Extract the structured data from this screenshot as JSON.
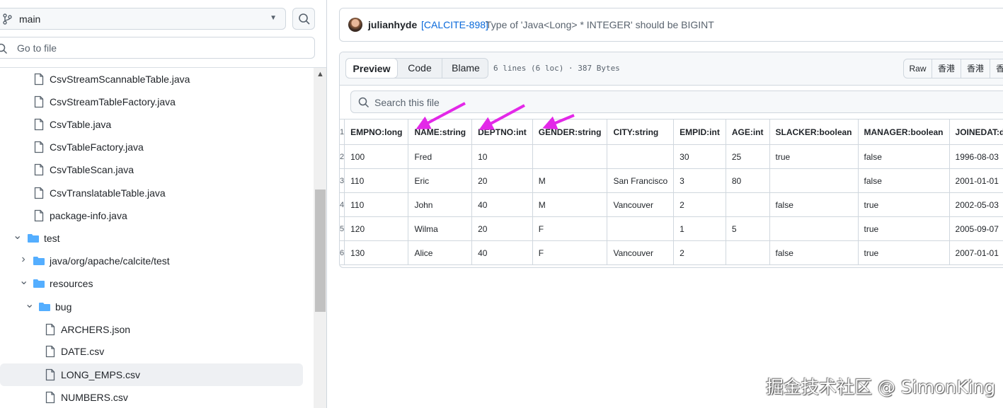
{
  "branch": {
    "name": "main"
  },
  "file_finder": {
    "placeholder": "Go to file"
  },
  "tree": [
    {
      "label": "CsvStreamScannableTable.java",
      "type": "file"
    },
    {
      "label": "CsvStreamTableFactory.java",
      "type": "file"
    },
    {
      "label": "CsvTable.java",
      "type": "file"
    },
    {
      "label": "CsvTableFactory.java",
      "type": "file"
    },
    {
      "label": "CsvTableScan.java",
      "type": "file"
    },
    {
      "label": "CsvTranslatableTable.java",
      "type": "file"
    },
    {
      "label": "package-info.java",
      "type": "file"
    },
    {
      "label": "test",
      "type": "folder",
      "expanded": true
    },
    {
      "label": "java/org/apache/calcite/test",
      "type": "folder",
      "expanded": false
    },
    {
      "label": "resources",
      "type": "folder",
      "expanded": true
    },
    {
      "label": "bug",
      "type": "folder",
      "expanded": true
    },
    {
      "label": "ARCHERS.json",
      "type": "file"
    },
    {
      "label": "DATE.csv",
      "type": "file"
    },
    {
      "label": "LONG_EMPS.csv",
      "type": "file",
      "selected": true
    },
    {
      "label": "NUMBERS.csv",
      "type": "file"
    }
  ],
  "commit": {
    "author": "julianhyde",
    "link": "[CALCITE-898]",
    "message": "Type of 'Java<Long> * INTEGER' should be BIGINT"
  },
  "file_view": {
    "tabs": {
      "preview": "Preview",
      "code": "Code",
      "blame": "Blame"
    },
    "meta": "6 lines (6 loc) · 387 Bytes",
    "actions": {
      "raw": "Raw",
      "btn2": "香港",
      "btn3": "香港",
      "btn4": "香"
    },
    "search_placeholder": "Search this file"
  },
  "csv": {
    "line_numbers": [
      "1",
      "2",
      "3",
      "4",
      "5",
      "6"
    ],
    "headers": [
      "EMPNO:long",
      "NAME:string",
      "DEPTNO:int",
      "GENDER:string",
      "CITY:string",
      "EMPID:int",
      "AGE:int",
      "SLACKER:boolean",
      "MANAGER:boolean",
      "JOINEDAT:date"
    ],
    "rows": [
      [
        "100",
        "Fred",
        "10",
        "",
        "",
        "30",
        "25",
        "true",
        "false",
        "1996-08-03"
      ],
      [
        "110",
        "Eric",
        "20",
        "M",
        "San Francisco",
        "3",
        "80",
        "",
        "false",
        "2001-01-01"
      ],
      [
        "110",
        "John",
        "40",
        "M",
        "Vancouver",
        "2",
        "",
        "false",
        "true",
        "2002-05-03"
      ],
      [
        "120",
        "Wilma",
        "20",
        "F",
        "",
        "1",
        "5",
        "",
        "true",
        "2005-09-07"
      ],
      [
        "130",
        "Alice",
        "40",
        "F",
        "Vancouver",
        "2",
        "",
        "false",
        "true",
        "2007-01-01"
      ]
    ]
  },
  "annotation_color": "#e328e8",
  "watermark": "掘金技术社区 @ SimonKing"
}
